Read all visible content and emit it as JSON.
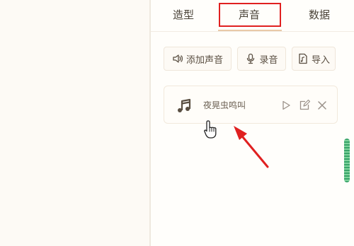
{
  "tabs": [
    {
      "label": "造型"
    },
    {
      "label": "声音"
    },
    {
      "label": "数据"
    }
  ],
  "active_tab": "声音",
  "toolbar": {
    "add_sound_label": "添加声音",
    "record_label": "录音",
    "import_label": "导入"
  },
  "sounds": [
    {
      "name": "夜晃虫鸣叫"
    }
  ],
  "colors": {
    "highlight_box": "#e02020",
    "annotation_arrow": "#e02020",
    "scrollbar": "#3aa56a"
  },
  "icons": {
    "add_sound": "speaker-icon",
    "record": "microphone-icon",
    "import": "music-file-icon",
    "sound_item": "music-note-icon",
    "play": "play-icon",
    "edit": "edit-icon",
    "delete": "close-icon"
  }
}
